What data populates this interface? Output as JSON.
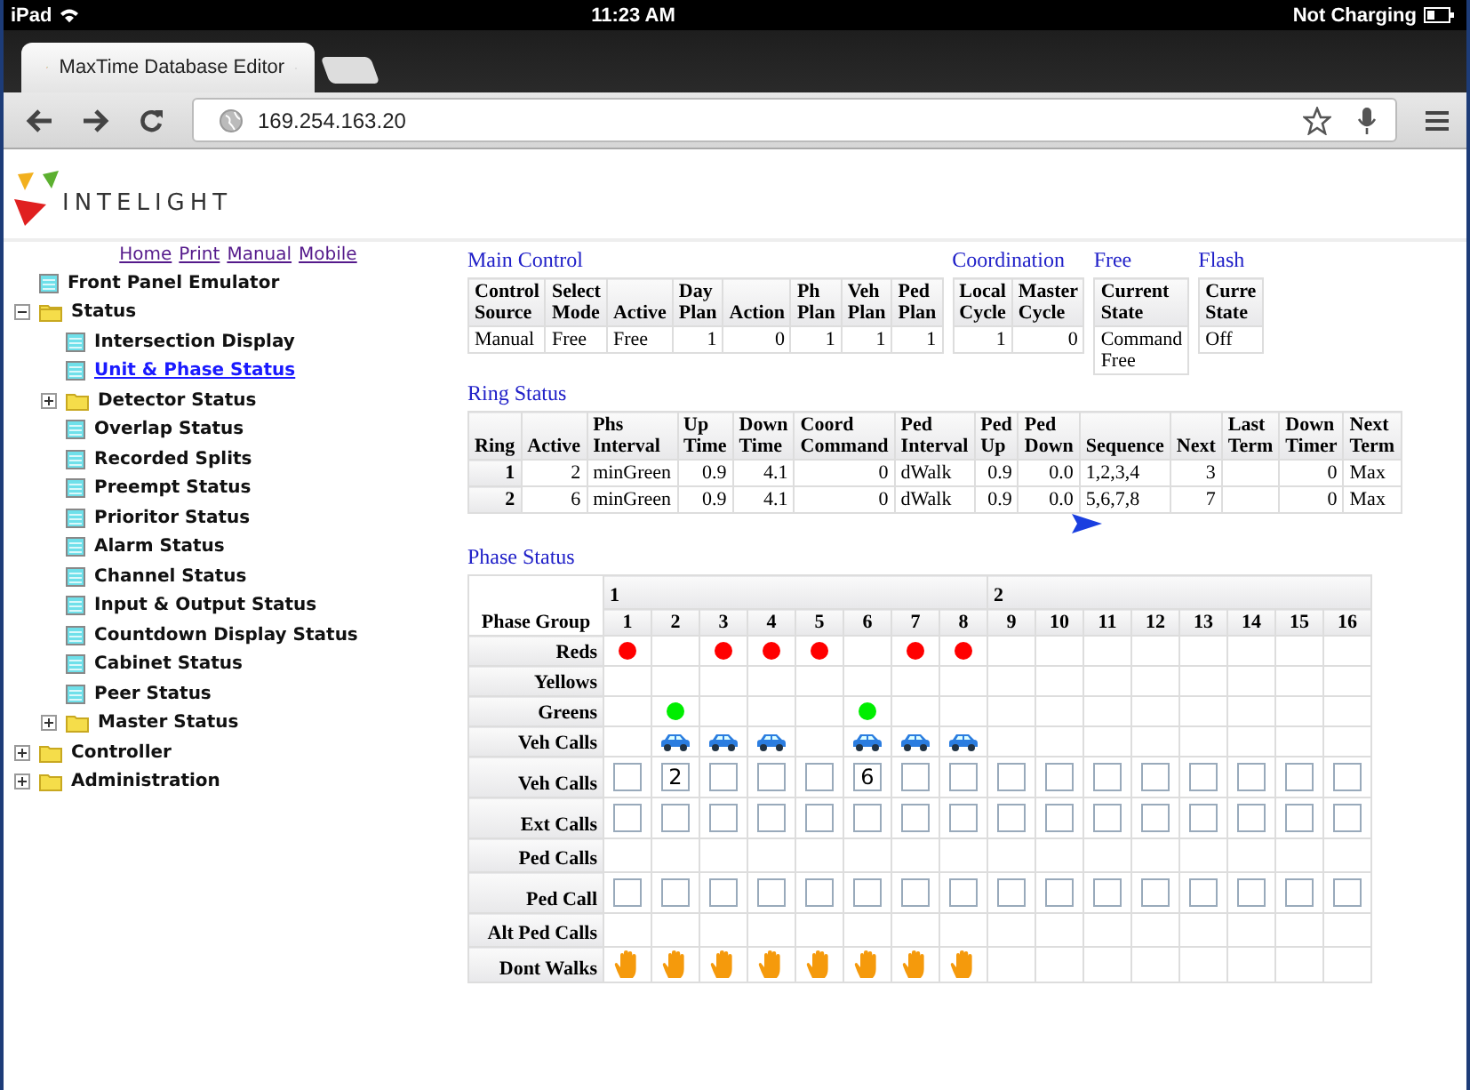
{
  "status_bar": {
    "device": "iPad",
    "time": "11:23 AM",
    "battery": "Not Charging"
  },
  "tabs": [
    {
      "label": "MaxTime Database Editor",
      "selected": true
    }
  ],
  "address": "169.254.163.20",
  "logo": {
    "text": "INTELIGHT"
  },
  "sidebar": {
    "links": [
      "Home",
      "Print",
      "Manual",
      "Mobile"
    ],
    "tree": [
      {
        "label": "Front Panel Emulator",
        "kind": "page",
        "selected": false
      },
      {
        "label": "Status",
        "kind": "folder",
        "expanded": true,
        "selected": false,
        "children": [
          {
            "label": "Intersection Display",
            "kind": "page",
            "selected": false
          },
          {
            "label": "Unit & Phase Status",
            "kind": "page",
            "selected": true
          },
          {
            "label": "Detector Status",
            "kind": "folder",
            "expanded": false,
            "selected": false
          },
          {
            "label": "Overlap Status",
            "kind": "page",
            "selected": false
          },
          {
            "label": "Recorded Splits",
            "kind": "page",
            "selected": false
          },
          {
            "label": "Preempt Status",
            "kind": "page",
            "selected": false
          },
          {
            "label": "Prioritor Status",
            "kind": "page",
            "selected": false
          },
          {
            "label": "Alarm Status",
            "kind": "page",
            "selected": false
          },
          {
            "label": "Channel Status",
            "kind": "page",
            "selected": false
          },
          {
            "label": "Input & Output Status",
            "kind": "page",
            "selected": false
          },
          {
            "label": "Countdown Display Status",
            "kind": "page",
            "selected": false
          },
          {
            "label": "Cabinet Status",
            "kind": "page",
            "selected": false
          },
          {
            "label": "Peer Status",
            "kind": "page",
            "selected": false
          },
          {
            "label": "Master Status",
            "kind": "folder",
            "expanded": false,
            "selected": false
          }
        ]
      },
      {
        "label": "Controller",
        "kind": "folder",
        "expanded": false,
        "selected": false
      },
      {
        "label": "Administration",
        "kind": "folder",
        "expanded": false,
        "selected": false
      }
    ]
  },
  "top_sections": [
    {
      "title": "Main Control",
      "columns": [
        {
          "label": "Control Source",
          "numeric": false
        },
        {
          "label": "Select Mode",
          "numeric": false
        },
        {
          "label": "Active",
          "numeric": false
        },
        {
          "label": "Day Plan",
          "numeric": true
        },
        {
          "label": "Action",
          "numeric": true
        },
        {
          "label": "Ph Plan",
          "numeric": true
        },
        {
          "label": "Veh Plan",
          "numeric": true
        },
        {
          "label": "Ped Plan",
          "numeric": true
        }
      ],
      "rows": [
        [
          "Manual",
          "Free",
          "Free",
          "1",
          "0",
          "1",
          "1",
          "1"
        ]
      ]
    },
    {
      "title": "Coordination",
      "columns": [
        {
          "label": "Local Cycle",
          "numeric": true
        },
        {
          "label": "Master Cycle",
          "numeric": true
        }
      ],
      "rows": [
        [
          "1",
          "0"
        ]
      ]
    },
    {
      "title": "Free",
      "columns": [
        {
          "label": "Current State",
          "numeric": false
        }
      ],
      "rows": [
        [
          "Command Free"
        ]
      ]
    },
    {
      "title": "Flash",
      "columns": [
        {
          "label": "Curre State",
          "numeric": false
        }
      ],
      "rows": [
        [
          "Off"
        ]
      ]
    }
  ],
  "ring_status": {
    "title": "Ring Status",
    "columns": [
      {
        "label": "Ring",
        "kind": "row_header"
      },
      {
        "label": "Active",
        "kind": "numeric"
      },
      {
        "label": "Phs Interval",
        "kind": "text"
      },
      {
        "label": "Up Time",
        "kind": "numeric"
      },
      {
        "label": "Down Time",
        "kind": "numeric"
      },
      {
        "label": "Coord Command",
        "kind": "numeric"
      },
      {
        "label": "Ped Interval",
        "kind": "text"
      },
      {
        "label": "Ped Up",
        "kind": "numeric"
      },
      {
        "label": "Ped Down",
        "kind": "numeric"
      },
      {
        "label": "Sequence",
        "kind": "text"
      },
      {
        "label": "Next",
        "kind": "numeric"
      },
      {
        "label": "Last Term",
        "kind": "numeric"
      },
      {
        "label": "Down Timer",
        "kind": "numeric"
      },
      {
        "label": "Next Term",
        "kind": "text"
      }
    ],
    "rows": [
      [
        "1",
        "2",
        "minGreen",
        "0.9",
        "4.1",
        "0",
        "dWalk",
        "0.9",
        "0.0",
        "1,2,3,4",
        "3",
        null,
        "0",
        "Max"
      ],
      [
        "2",
        "6",
        "minGreen",
        "0.9",
        "4.1",
        "0",
        "dWalk",
        "0.9",
        "0.0",
        "5,6,7,8",
        "7",
        null,
        "0",
        "Max"
      ]
    ]
  },
  "phase_status": {
    "title": "Phase Status",
    "group_label": "Phase Group",
    "groups": [
      {
        "label": "1",
        "phases": [
          "1",
          "2",
          "3",
          "4",
          "5",
          "6",
          "7",
          "8"
        ]
      },
      {
        "label": "2",
        "phases": [
          "9",
          "10",
          "11",
          "12",
          "13",
          "14",
          "15",
          "16"
        ]
      }
    ],
    "rows": [
      {
        "label": "Reds",
        "kind": "lamp",
        "color": "#ff0000",
        "on": [
          true,
          false,
          true,
          true,
          true,
          false,
          true,
          true,
          false,
          false,
          false,
          false,
          false,
          false,
          false,
          false
        ]
      },
      {
        "label": "Yellows",
        "kind": "lamp",
        "on": [
          false,
          false,
          false,
          false,
          false,
          false,
          false,
          false,
          false,
          false,
          false,
          false,
          false,
          false,
          false,
          false
        ]
      },
      {
        "label": "Greens",
        "kind": "lamp",
        "color": "#00ee00",
        "on": [
          false,
          true,
          false,
          false,
          false,
          true,
          false,
          false,
          false,
          false,
          false,
          false,
          false,
          false,
          false,
          false
        ]
      },
      {
        "label": "Veh Calls",
        "kind": "car",
        "on": [
          false,
          true,
          true,
          true,
          false,
          true,
          true,
          true,
          false,
          false,
          false,
          false,
          false,
          false,
          false,
          false
        ]
      },
      {
        "label": "Veh Calls",
        "kind": "input",
        "cells": [
          null,
          "2",
          null,
          null,
          null,
          "6",
          null,
          null,
          null,
          null,
          null,
          null,
          null,
          null,
          null,
          null
        ]
      },
      {
        "label": "Ext Calls",
        "kind": "input",
        "cells": [
          null,
          null,
          null,
          null,
          null,
          null,
          null,
          null,
          null,
          null,
          null,
          null,
          null,
          null,
          null,
          null
        ]
      },
      {
        "label": "Ped Calls",
        "kind": "blank"
      },
      {
        "label": "Ped Call",
        "kind": "input",
        "cells": [
          null,
          null,
          null,
          null,
          null,
          null,
          null,
          null,
          null,
          null,
          null,
          null,
          null,
          null,
          null,
          null
        ]
      },
      {
        "label": "Alt Ped Calls",
        "kind": "blank"
      },
      {
        "label": "Dont Walks",
        "kind": "hand",
        "on": [
          true,
          true,
          true,
          true,
          true,
          true,
          true,
          true,
          false,
          false,
          false,
          false,
          false,
          false,
          false,
          false
        ]
      }
    ]
  }
}
